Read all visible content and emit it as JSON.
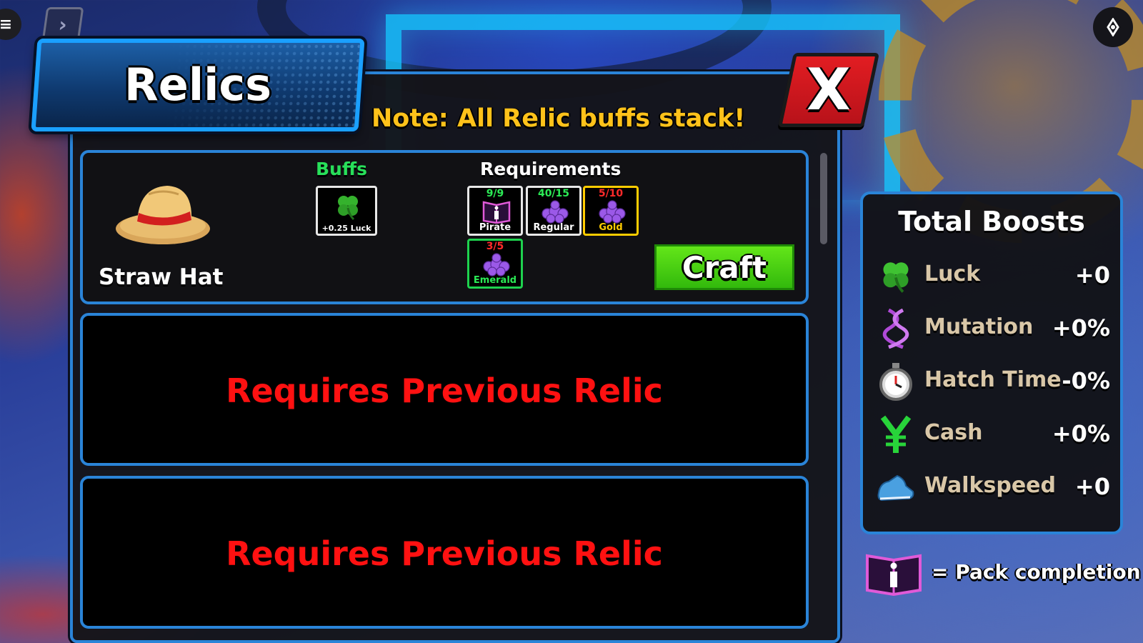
{
  "window": {
    "title": "Relics",
    "note": "Note: All Relic buffs stack!",
    "close_label": "X"
  },
  "relic_list": {
    "items": [
      {
        "name": "Straw Hat",
        "icon": "straw-hat",
        "buffs_header": "Buffs",
        "requirements_header": "Requirements",
        "buffs": [
          {
            "label": "+0.25 Luck",
            "icon": "clover-icon"
          }
        ],
        "requirements": [
          {
            "progress": "9/9",
            "label": "Pirate",
            "icon": "pack-book-icon",
            "met": true
          },
          {
            "progress": "40/15",
            "label": "Regular",
            "icon": "fruit-icon",
            "met": true
          },
          {
            "progress": "5/10",
            "label": "Gold",
            "icon": "fruit-icon",
            "met": false
          },
          {
            "progress": "3/5",
            "label": "Emerald",
            "icon": "fruit-icon",
            "met": false
          }
        ],
        "action_label": "Craft"
      },
      {
        "locked_text": "Requires Previous Relic"
      },
      {
        "locked_text": "Requires Previous Relic"
      }
    ]
  },
  "total_boosts": {
    "title": "Total Boosts",
    "rows": [
      {
        "label": "Luck",
        "value": "+0",
        "icon": "clover-icon"
      },
      {
        "label": "Mutation",
        "value": "+0%",
        "icon": "dna-icon"
      },
      {
        "label": "Hatch Time",
        "value": "-0%",
        "icon": "stopwatch-icon"
      },
      {
        "label": "Cash",
        "value": "+0%",
        "icon": "yen-icon"
      },
      {
        "label": "Walkspeed",
        "value": "+0",
        "icon": "shoe-icon"
      }
    ]
  },
  "legend": {
    "text": "= Pack completion",
    "icon": "pack-book-icon"
  },
  "colors": {
    "accent_blue": "#2a84d8",
    "note_yellow": "#ffc21a",
    "met_green": "#2bea55",
    "unmet_red": "#ff2a2a",
    "locked_red": "#ff1111",
    "craft_green": "#4ccf12"
  }
}
